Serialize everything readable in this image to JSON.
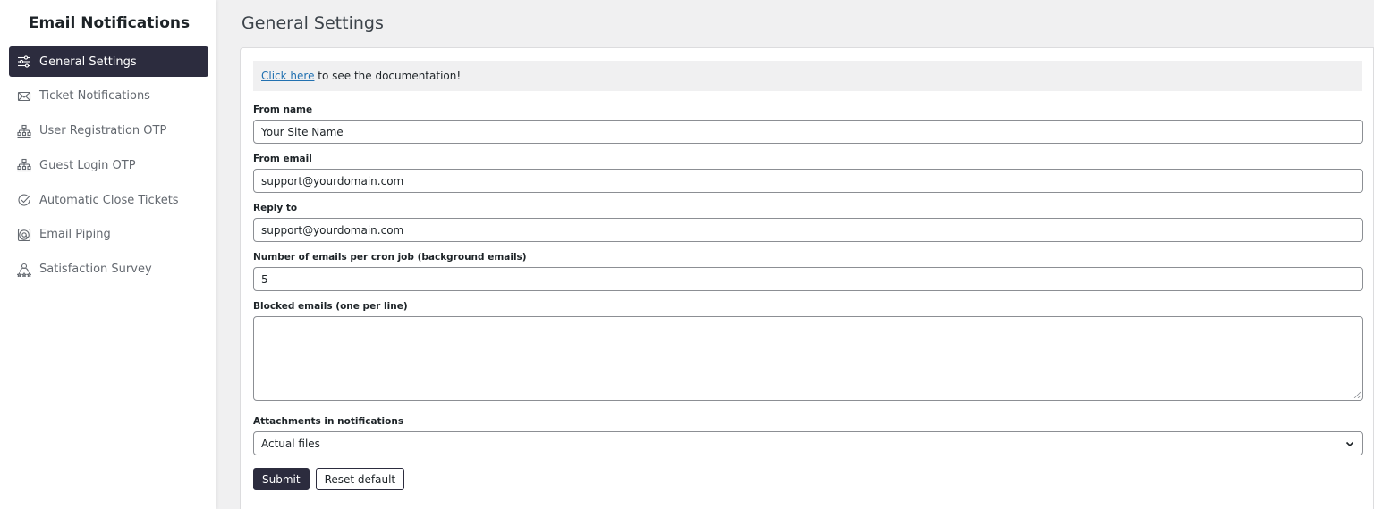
{
  "sidebar": {
    "title": "Email Notifications",
    "items": [
      {
        "label": "General Settings",
        "icon": "sliders-icon",
        "active": true
      },
      {
        "label": "Ticket Notifications",
        "icon": "envelope-icon",
        "active": false
      },
      {
        "label": "User Registration OTP",
        "icon": "network-icon",
        "active": false
      },
      {
        "label": "Guest Login OTP",
        "icon": "network-icon",
        "active": false
      },
      {
        "label": "Automatic Close Tickets",
        "icon": "check-circle-icon",
        "active": false
      },
      {
        "label": "Email Piping",
        "icon": "at-sign-icon",
        "active": false
      },
      {
        "label": "Satisfaction Survey",
        "icon": "users-star-icon",
        "active": false
      }
    ]
  },
  "main": {
    "title": "General Settings",
    "notice": {
      "link_text": "Click here",
      "text": " to see the documentation!"
    },
    "fields": {
      "from_name": {
        "label": "From name",
        "value": "Your Site Name"
      },
      "from_email": {
        "label": "From email",
        "value": "support@yourdomain.com"
      },
      "reply_to": {
        "label": "Reply to",
        "value": "support@yourdomain.com"
      },
      "emails_per_cron": {
        "label": "Number of emails per cron job (background emails)",
        "value": "5"
      },
      "blocked_emails": {
        "label": "Blocked emails (one per line)",
        "value": ""
      },
      "attachments": {
        "label": "Attachments in notifications",
        "value": "Actual files"
      }
    },
    "buttons": {
      "submit": "Submit",
      "reset": "Reset default"
    }
  },
  "colors": {
    "accent": "#2c2c3e",
    "link": "#2271b1"
  }
}
